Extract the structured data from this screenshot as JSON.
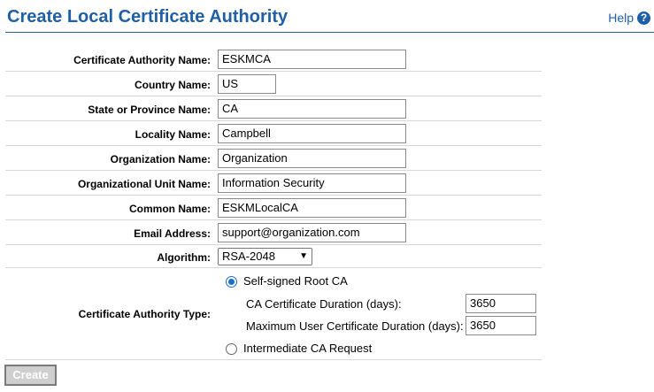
{
  "header": {
    "title": "Create Local Certificate Authority",
    "help_label": "Help",
    "help_icon": "question-circle-icon"
  },
  "fields": {
    "ca_name": {
      "label": "Certificate Authority Name:",
      "value": "ESKMCA"
    },
    "country": {
      "label": "Country Name:",
      "value": "US"
    },
    "state": {
      "label": "State or Province Name:",
      "value": "CA"
    },
    "locality": {
      "label": "Locality Name:",
      "value": "Campbell"
    },
    "org": {
      "label": "Organization Name:",
      "value": "Organization"
    },
    "org_unit": {
      "label": "Organizational Unit Name:",
      "value": "Information Security"
    },
    "common_name": {
      "label": "Common Name:",
      "value": "ESKMLocalCA"
    },
    "email": {
      "label": "Email Address:",
      "value": "support@organization.com"
    },
    "algorithm": {
      "label": "Algorithm:",
      "value": "RSA-2048"
    }
  },
  "ca_type": {
    "label": "Certificate Authority Type:",
    "options": {
      "self_signed": {
        "label": "Self-signed Root CA",
        "checked": true
      },
      "intermediate": {
        "label": "Intermediate CA Request",
        "checked": false
      }
    },
    "ca_duration": {
      "label": "CA Certificate Duration (days):",
      "value": "3650"
    },
    "max_user_duration": {
      "label": "Maximum User Certificate Duration (days):",
      "value": "3650"
    }
  },
  "actions": {
    "create_label": "Create"
  },
  "colors": {
    "accent": "#1f5fa6",
    "radio_selected": "#1a6fc9"
  }
}
